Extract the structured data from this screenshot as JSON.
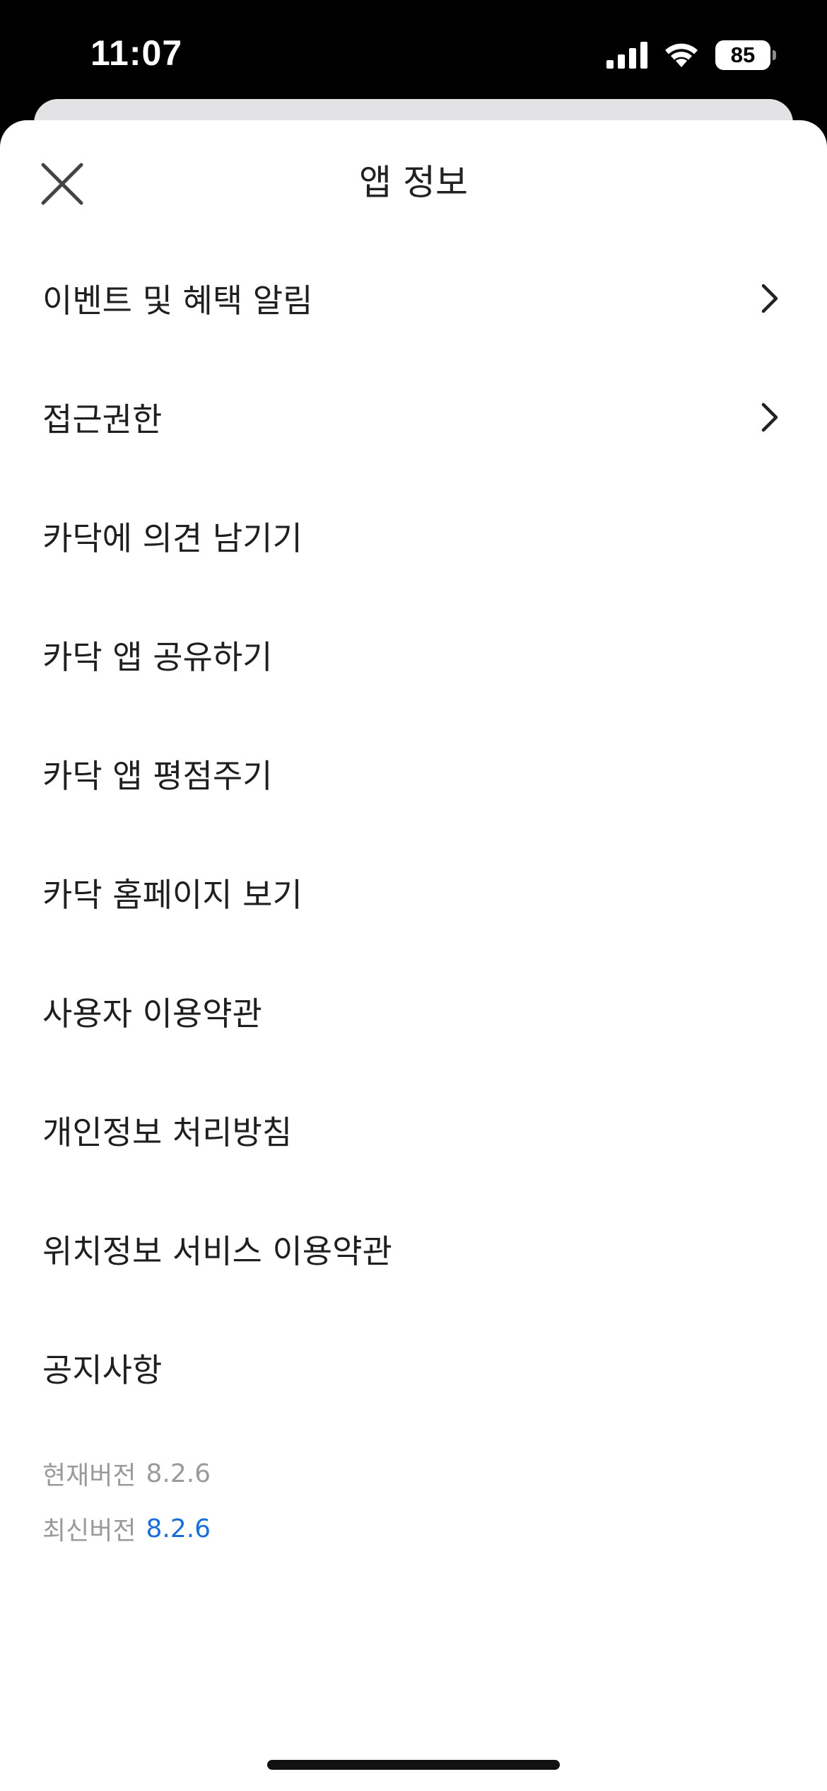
{
  "status_bar": {
    "time": "11:07",
    "battery": "85"
  },
  "header": {
    "title": "앱 정보"
  },
  "menu": {
    "items": [
      {
        "label": "이벤트 및 혜택 알림",
        "has_chevron": true
      },
      {
        "label": "접근권한",
        "has_chevron": true
      },
      {
        "label": "카닥에 의견 남기기",
        "has_chevron": false
      },
      {
        "label": "카닥 앱 공유하기",
        "has_chevron": false
      },
      {
        "label": "카닥 앱 평점주기",
        "has_chevron": false
      },
      {
        "label": "카닥 홈페이지 보기",
        "has_chevron": false
      },
      {
        "label": "사용자 이용약관",
        "has_chevron": false
      },
      {
        "label": "개인정보 처리방침",
        "has_chevron": false
      },
      {
        "label": "위치정보 서비스 이용약관",
        "has_chevron": false
      },
      {
        "label": "공지사항",
        "has_chevron": false
      }
    ]
  },
  "version": {
    "current_label": "현재버전",
    "current_value": "8.2.6",
    "latest_label": "최신버전",
    "latest_value": "8.2.6"
  },
  "colors": {
    "accent": "#1a6ed8",
    "muted": "#9a9a9a"
  }
}
